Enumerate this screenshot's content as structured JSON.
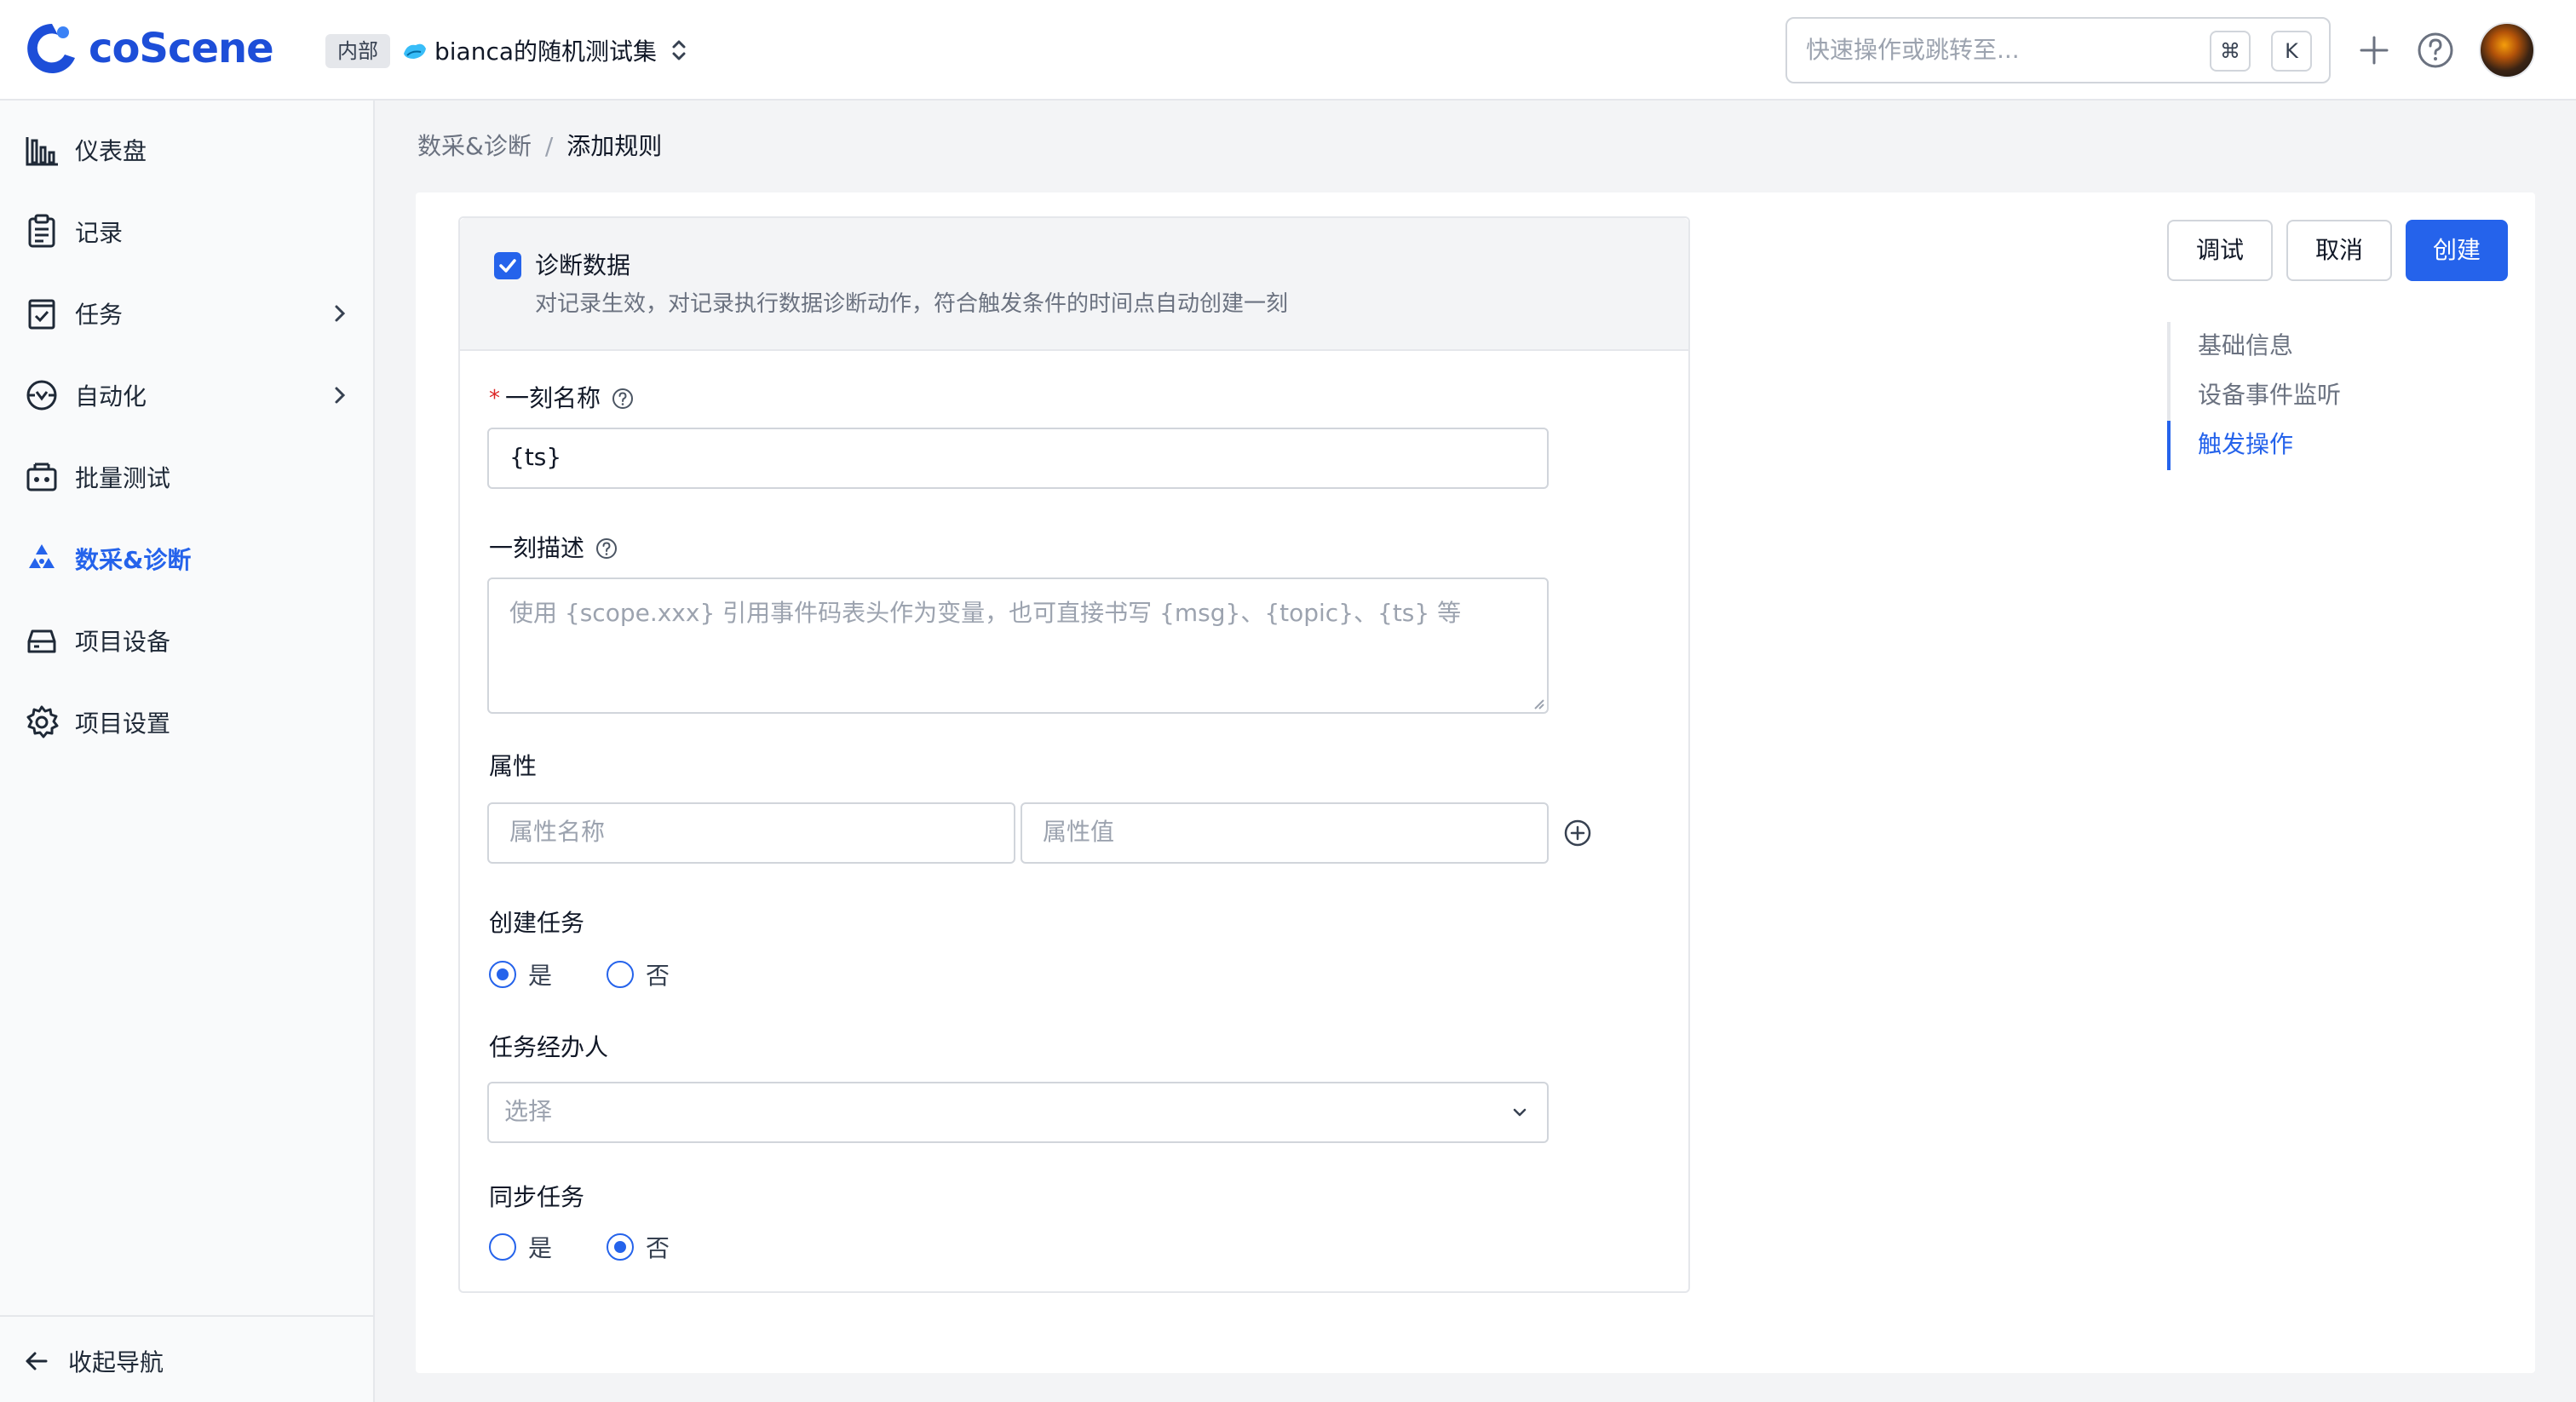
{
  "header": {
    "brand": "coScene",
    "workspace_badge": "内部",
    "workspace_name": "bianca的随机测试集",
    "search_placeholder": "快速操作或跳转至...",
    "shortcut_cmd": "⌘",
    "shortcut_key": "K",
    "plus_icon": "plus-icon",
    "help_icon": "help-circle-icon"
  },
  "sidebar": {
    "items": [
      {
        "label": "仪表盘",
        "icon": "bar-chart-icon"
      },
      {
        "label": "记录",
        "icon": "clipboard-icon"
      },
      {
        "label": "任务",
        "icon": "task-icon"
      },
      {
        "label": "自动化",
        "icon": "automation-icon"
      },
      {
        "label": "批量测试",
        "icon": "batch-test-icon"
      },
      {
        "label": "数采&诊断",
        "icon": "diagnosis-icon"
      },
      {
        "label": "项目设备",
        "icon": "device-icon"
      },
      {
        "label": "项目设置",
        "icon": "gear-icon"
      }
    ],
    "active_index": 5,
    "collapse_label": "收起导航"
  },
  "breadcrumb": {
    "parent": "数采&诊断",
    "separator": "/",
    "current": "添加规则"
  },
  "form": {
    "section_title": "诊断数据",
    "section_checked": true,
    "section_desc": "对记录生效，对记录执行数据诊断动作，符合触发条件的时间点自动创建一刻",
    "moment_name": {
      "label": "一刻名称",
      "required_mark": "*",
      "value": "{ts}"
    },
    "moment_desc": {
      "label": "一刻描述",
      "placeholder": "使用 {scope.xxx} 引用事件码表头作为变量，也可直接书写 {msg}、{topic}、{ts} 等"
    },
    "attributes": {
      "label": "属性",
      "name_placeholder": "属性名称",
      "value_placeholder": "属性值"
    },
    "create_task": {
      "label": "创建任务",
      "options": [
        "是",
        "否"
      ],
      "selected": "是"
    },
    "task_assignee": {
      "label": "任务经办人",
      "placeholder": "选择"
    },
    "sync_task": {
      "label": "同步任务",
      "options": [
        "是",
        "否"
      ],
      "selected": "否"
    }
  },
  "actions": {
    "debug": "调试",
    "cancel": "取消",
    "create": "创建"
  },
  "anchors": {
    "items": [
      "基础信息",
      "设备事件监听",
      "触发操作"
    ],
    "active_index": 2
  },
  "colors": {
    "accent": "#2563eb",
    "required": "#dc2626",
    "brand": "#1d4ed8"
  }
}
